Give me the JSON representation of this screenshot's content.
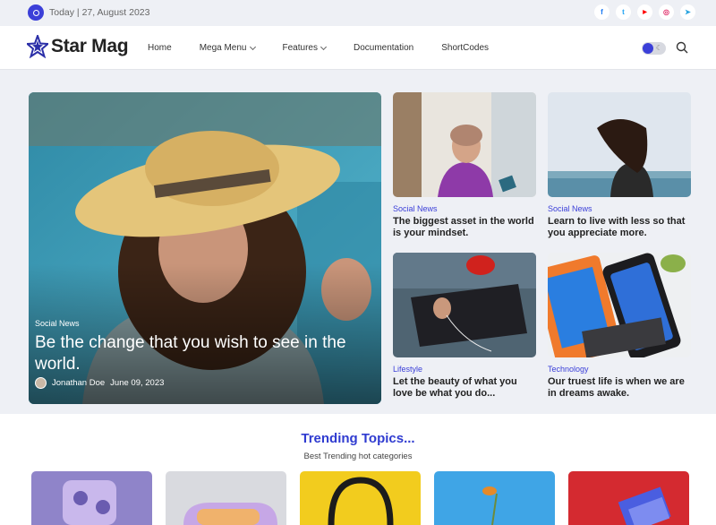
{
  "topbar": {
    "today": "Today | 27, August 2023",
    "socials": [
      {
        "icon": "facebook-icon",
        "glyph": "f",
        "color": "#1877f2"
      },
      {
        "icon": "twitter-icon",
        "glyph": "t",
        "color": "#1da1f2"
      },
      {
        "icon": "youtube-icon",
        "glyph": "▶",
        "color": "#ff0000"
      },
      {
        "icon": "instagram-icon",
        "glyph": "◎",
        "color": "#e1306c"
      },
      {
        "icon": "telegram-icon",
        "glyph": "➤",
        "color": "#2aa4e0"
      }
    ]
  },
  "header": {
    "logo": "Star Mag",
    "nav": [
      {
        "label": "Home",
        "dropdown": false
      },
      {
        "label": "Mega Menu",
        "dropdown": true
      },
      {
        "label": "Features",
        "dropdown": true
      },
      {
        "label": "Documentation",
        "dropdown": false
      },
      {
        "label": "ShortCodes",
        "dropdown": false
      }
    ],
    "accent": "#3b3fd8"
  },
  "hero": {
    "category": "Social News",
    "title": "Be the change that you wish to see in the world.",
    "author": "Jonathan Doe",
    "date": "June 09, 2023"
  },
  "cards": [
    {
      "category": "Social News",
      "title": "The biggest asset in the world is your mindset."
    },
    {
      "category": "Social News",
      "title": "Learn to live with less so that you appreciate more."
    },
    {
      "category": "Lifestyle",
      "title": "Let the beauty of what you love be what you do..."
    },
    {
      "category": "Technology",
      "title": "Our truest life is when we are in dreams awake."
    }
  ],
  "trending": {
    "title": "Trending Topics...",
    "subtitle": "Best Trending hot categories"
  }
}
